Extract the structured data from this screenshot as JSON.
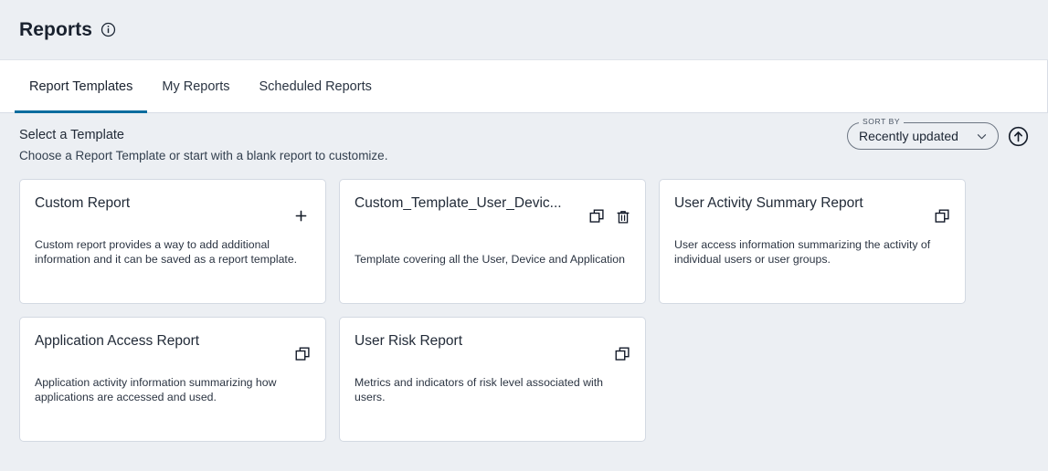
{
  "header": {
    "title": "Reports",
    "info_icon": "info-circle-icon"
  },
  "tabs": [
    {
      "label": "Report Templates",
      "active": true
    },
    {
      "label": "My Reports",
      "active": false
    },
    {
      "label": "Scheduled Reports",
      "active": false
    }
  ],
  "section": {
    "title": "Select a Template",
    "subtitle": "Choose a Report Template or start with a blank report to customize."
  },
  "sort": {
    "legend": "SORT BY",
    "value": "Recently updated",
    "options": [
      "Recently updated"
    ],
    "chevron_icon": "chevron-down-icon",
    "direction_icon": "arrow-up-circle-icon"
  },
  "colors": {
    "accent": "#0a6c9e",
    "page_background": "#eceff3",
    "card_background": "#ffffff",
    "card_border": "#d3d9e2",
    "text": "#222b38"
  },
  "cards": [
    {
      "title": "Custom Report",
      "description": "Custom report provides a way to add additional information and it can be saved as a report template.",
      "actions": [
        "plus-icon"
      ]
    },
    {
      "title": "Custom_Template_User_Devic...",
      "description": "Template covering all the User, Device and Application",
      "actions": [
        "copy-icon",
        "trash-icon"
      ]
    },
    {
      "title": "User Activity Summary Report",
      "description": "User access information summarizing the activity of individual users or user groups.",
      "actions": [
        "copy-icon"
      ]
    },
    {
      "title": "Application Access Report",
      "description": "Application activity information summarizing how applications are accessed and used.",
      "actions": [
        "copy-icon"
      ]
    },
    {
      "title": "User Risk Report",
      "description": "Metrics and indicators of risk level associated with users.",
      "actions": [
        "copy-icon"
      ]
    }
  ]
}
